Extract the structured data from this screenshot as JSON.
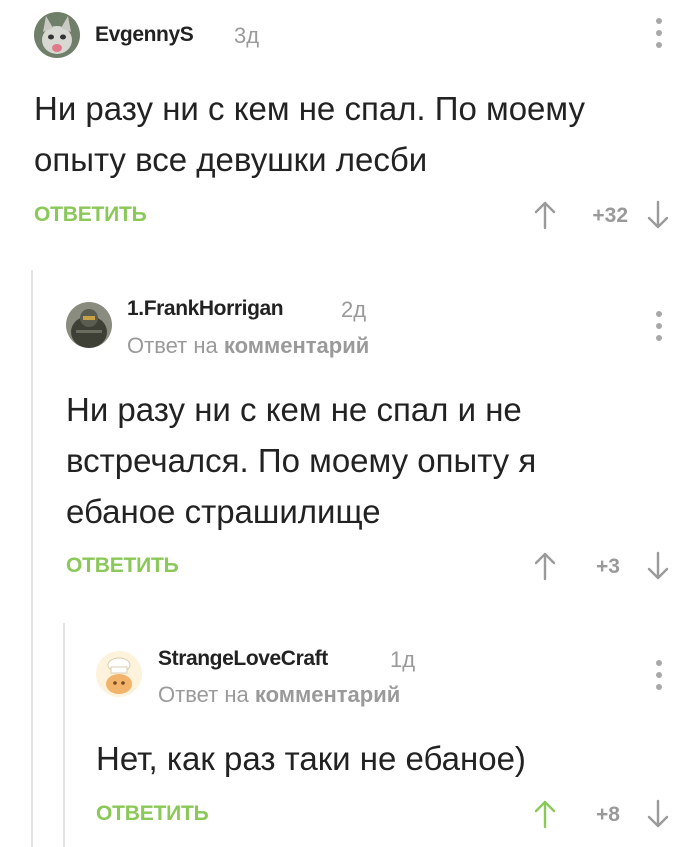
{
  "comments": [
    {
      "author": "EvgennyS",
      "time": "3д",
      "reply_prefix": "",
      "reply_link": "",
      "text_lines": [
        "Ни разу ни с кем не спал. По моему",
        "опыту все девушки лесби"
      ],
      "reply_label": "ОТВЕТИТЬ",
      "rating": "+32",
      "avatar": "cat-avatar",
      "upvoted": false
    },
    {
      "author": "1.FrankHorrigan",
      "time": "2д",
      "reply_prefix": "Ответ на",
      "reply_link": "комментарий",
      "text_lines": [
        "Ни разу ни с кем не спал и не",
        "встречался. По моему опыту я",
        "ебаное страшилище"
      ],
      "reply_label": "ОТВЕТИТЬ",
      "rating": "+3",
      "avatar": "armor-avatar",
      "upvoted": false
    },
    {
      "author": "StrangeLoveCraft",
      "time": "1д",
      "reply_prefix": "Ответ на",
      "reply_link": "комментарий",
      "text_lines": [
        "Нет, как раз таки не ебаное)"
      ],
      "reply_label": "ОТВЕТИТЬ",
      "rating": "+8",
      "avatar": "chef-avatar",
      "upvoted": true
    }
  ],
  "colors": {
    "accent": "#8ac858",
    "muted": "#9a9a9a",
    "text": "#222222",
    "thread_line": "#e3e3e3"
  }
}
